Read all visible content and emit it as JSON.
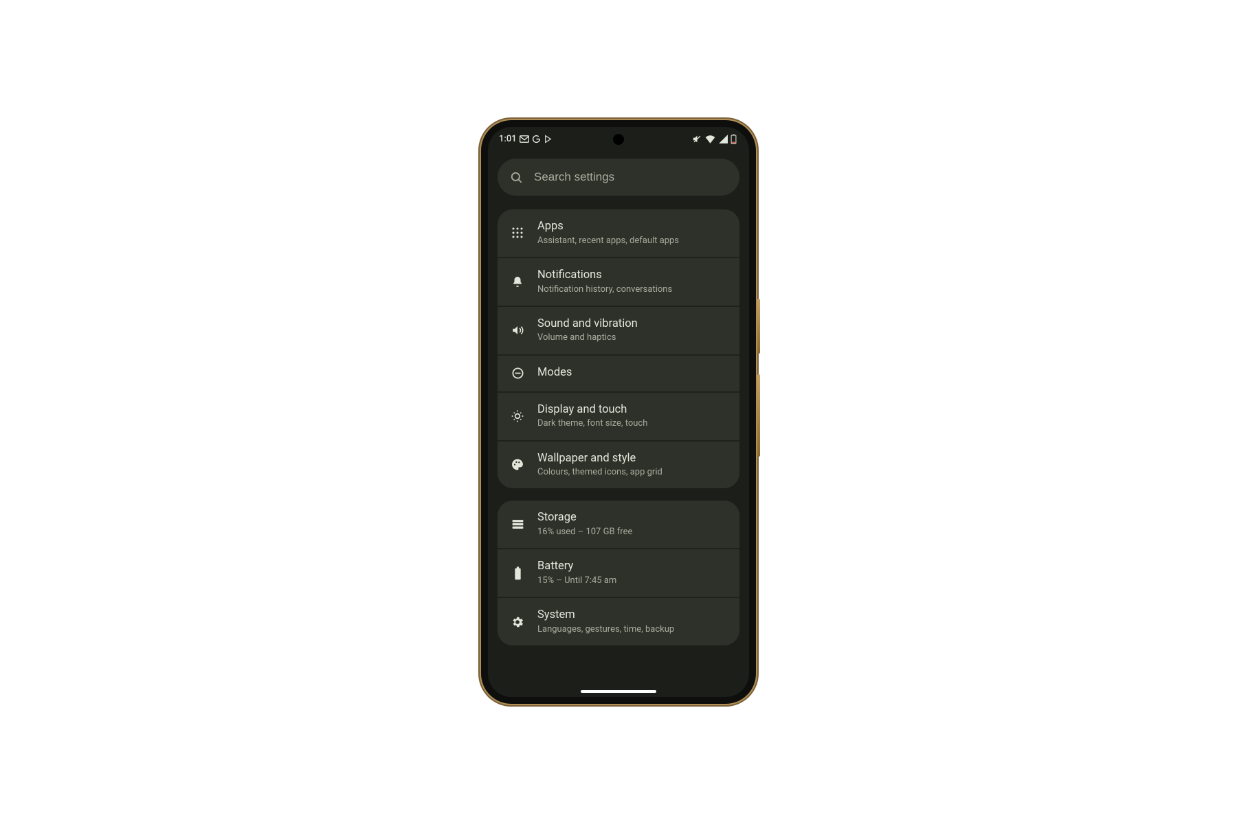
{
  "status": {
    "time": "1:01",
    "left_icons": [
      "gmail-icon",
      "google-g-icon",
      "play-store-icon"
    ],
    "right_icons": [
      "mute-icon",
      "wifi-icon",
      "signal-icon",
      "battery-low-icon"
    ]
  },
  "search": {
    "placeholder": "Search settings",
    "value": ""
  },
  "groups": [
    {
      "rows": [
        {
          "id": "apps",
          "icon": "apps-grid-icon",
          "title": "Apps",
          "subtitle": "Assistant, recent apps, default apps"
        },
        {
          "id": "notifications",
          "icon": "bell-icon",
          "title": "Notifications",
          "subtitle": "Notification history, conversations"
        },
        {
          "id": "sound",
          "icon": "volume-icon",
          "title": "Sound and vibration",
          "subtitle": "Volume and haptics"
        },
        {
          "id": "modes",
          "icon": "dnd-icon",
          "title": "Modes",
          "subtitle": ""
        },
        {
          "id": "display",
          "icon": "brightness-icon",
          "title": "Display and touch",
          "subtitle": "Dark theme, font size, touch"
        },
        {
          "id": "wallpaper",
          "icon": "palette-icon",
          "title": "Wallpaper and style",
          "subtitle": "Colours, themed icons, app grid"
        }
      ]
    },
    {
      "rows": [
        {
          "id": "storage",
          "icon": "storage-icon",
          "title": "Storage",
          "subtitle": "16% used – 107 GB free"
        },
        {
          "id": "battery",
          "icon": "battery-icon",
          "title": "Battery",
          "subtitle": "15% – Until 7:45 am"
        },
        {
          "id": "system",
          "icon": "gear-icon",
          "title": "System",
          "subtitle": "Languages, gestures, time, backup"
        }
      ]
    }
  ]
}
